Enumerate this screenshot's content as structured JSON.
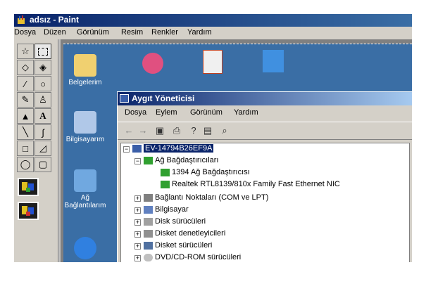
{
  "paint": {
    "title": "adsız - Paint",
    "menu": [
      "Dosya",
      "Düzen",
      "Görünüm",
      "Resim",
      "Renkler",
      "Yardım"
    ]
  },
  "desktop": {
    "icons": [
      {
        "label": "Belgelerim",
        "icon": "my-documents-icon"
      },
      {
        "label": "Bilgisayarım",
        "icon": "my-computer-icon"
      },
      {
        "label": "Ağ Bağlantılarım",
        "icon": "network-places-icon"
      },
      {
        "label": "",
        "icon": "internet-explorer-icon"
      }
    ]
  },
  "device_manager": {
    "title": "Aygıt Yöneticisi",
    "menu": [
      "Dosya",
      "Eylem",
      "Görünüm",
      "Yardım"
    ],
    "toolbar": [
      "back-icon",
      "forward-icon",
      "properties-icon",
      "print-icon",
      "help-icon",
      "view-icon",
      "scan-hardware-icon"
    ],
    "root": "EV-14794B26EF9A",
    "network_adapters": {
      "label": "Ağ Bağdaştırıcıları",
      "children": [
        "1394 Ağ Bağdaştırıcısı",
        "Realtek RTL8139/810x Family Fast Ethernet NIC"
      ]
    },
    "categories": [
      "Bağlantı Noktaları (COM ve LPT)",
      "Bilgisayar",
      "Disk sürücüleri",
      "Disket denetleyicileri",
      "Disket sürücüleri",
      "DVD/CD-ROM sürücüleri"
    ]
  },
  "colors": {
    "title_bar": "#0a246a",
    "desktop": "#3a6ea5",
    "window_face": "#d4d0c8"
  }
}
